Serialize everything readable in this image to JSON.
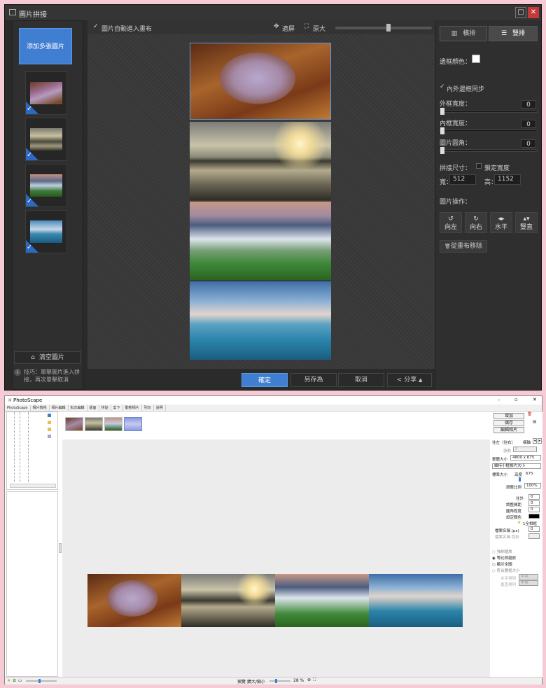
{
  "top_window": {
    "title": "圖片拼接",
    "controls": {
      "maximize": "□",
      "close": "✕"
    },
    "left_panel": {
      "add_button": "添加多張圖片",
      "clear_button": "清空圖片",
      "tip": "技巧：單擊圖片進入拼接，再次單擊取消",
      "tip_icon": "i"
    },
    "toolbar": {
      "auto_canvas_check": "✓",
      "auto_canvas_label": "圖片自動進入畫布",
      "fit_label": "適屏",
      "original_label": "原大",
      "zoom_fraction": 0.55
    },
    "right_panel": {
      "tab_horizontal": "橫排",
      "tab_vertical": "豎排",
      "border_color_label": "邊框顏色：",
      "sync_check": "✓",
      "sync_label": "內外邊框同步",
      "outer_border_label": "外框寬度：",
      "outer_border_value": "0",
      "inner_border_label": "內框寬度：",
      "inner_border_value": "0",
      "corner_label": "圖片圓角：",
      "corner_value": "0",
      "size_label": "拼接尺寸：",
      "lock_width_label": "鎖定寬度",
      "width_label": "寬：",
      "width_value": "512",
      "height_label": "高：",
      "height_value": "1152",
      "ops_label": "圖片操作：",
      "ops": [
        {
          "icon": "↺",
          "label": "向左"
        },
        {
          "icon": "↻",
          "label": "向右"
        },
        {
          "icon": "◂▸",
          "label": "水平"
        },
        {
          "icon": "▴▾",
          "label": "豎直"
        }
      ],
      "remove_button": "從畫布移除",
      "remove_icon": "🗑"
    },
    "bottom_buttons": {
      "ok": "確定",
      "save_as": "另存為",
      "cancel": "取消",
      "share": "分享",
      "share_icon": "<",
      "share_caret": "▲"
    }
  },
  "bottom_window": {
    "title": "PhotoScape",
    "tabs": [
      "PhotoScape",
      "相片檢視",
      "相片編輯",
      "批次編輯",
      "版面",
      "拼貼",
      "剪下",
      "動態相片",
      "列印",
      "說明"
    ],
    "right_panel": {
      "add_button": "增加",
      "save_button": "儲存",
      "edit_button": "編輯相片",
      "mode_label": "往左（往右）",
      "mode_label2": "橫軸",
      "count_label": "張數",
      "count_value": "2",
      "total_size_label": "整體大小",
      "total_size_value": "4800 x 675",
      "select_value": "維持小框相片大小",
      "std_size_label": "標準大小",
      "height_label": "高度",
      "height_value": "675",
      "ratio_label": "調整比例",
      "ratio_value": "100%",
      "outer_label": "往外",
      "outer_value": "0",
      "gap_label": "調整間距",
      "gap_value": "0",
      "corner_label": "圓角程度",
      "corner_value": "0",
      "color_label": "設定顏色",
      "frame_label": "1全相框",
      "filename_label": "檔案名稱 (px)",
      "filename_value": "0",
      "filename2_label": "檔案名稱 色彩",
      "radio1": "強制縮放",
      "radio2": "等比例縮放",
      "radio3": "顯示全圖",
      "radio4": "符合圖框大小",
      "halign_label": "水平排列",
      "valign_label": "垂直排列",
      "halign_value": "中央",
      "valign_value": "中央"
    },
    "status": {
      "preview_label": "預覽 擴大/縮小",
      "zoom_value": "28 %",
      "zoom_fraction": 0.3
    }
  },
  "colors": {
    "accent": "#3f7ed0",
    "dark_bg": "#2a2a2a",
    "close_red": "#c43a3a"
  }
}
